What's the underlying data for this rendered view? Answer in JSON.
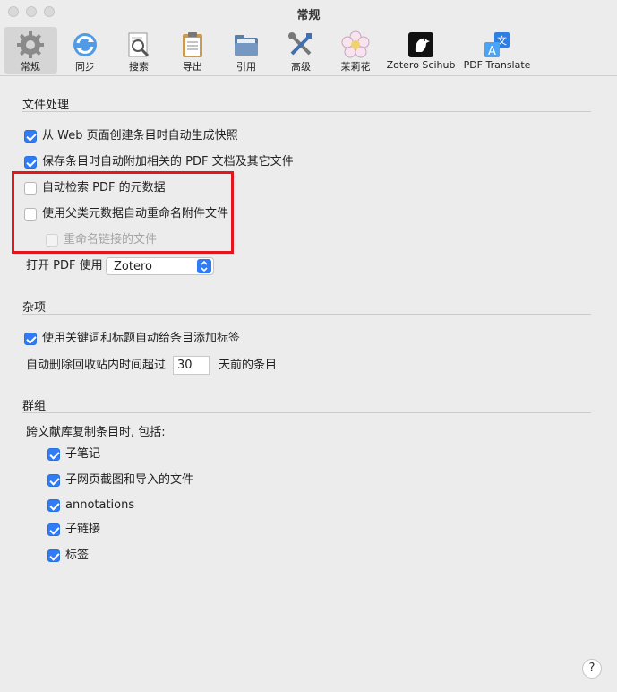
{
  "window": {
    "title": "常规"
  },
  "toolbar": {
    "items": [
      {
        "label": "常规"
      },
      {
        "label": "同步"
      },
      {
        "label": "搜索"
      },
      {
        "label": "导出"
      },
      {
        "label": "引用"
      },
      {
        "label": "高级"
      },
      {
        "label": "茉莉花"
      },
      {
        "label": "Zotero Scihub"
      },
      {
        "label": "PDF Translate"
      }
    ]
  },
  "file_handling": {
    "title": "文件处理",
    "snapshot": "从 Web 页面创建条目时自动生成快照",
    "attach_pdf": "保存条目时自动附加相关的 PDF 文档及其它文件",
    "retrieve_metadata": "自动检索 PDF 的元数据",
    "rename_attachments": "使用父类元数据自动重命名附件文件",
    "rename_linked": "重命名链接的文件",
    "open_pdf_label": "打开 PDF 使用",
    "open_pdf_value": "Zotero"
  },
  "misc": {
    "title": "杂项",
    "auto_tags": "使用关键词和标题自动给条目添加标签",
    "trash_prefix": "自动删除回收站内时间超过",
    "trash_days": "30",
    "trash_suffix": "天前的条目"
  },
  "groups": {
    "title": "群组",
    "copy_label": "跨文献库复制条目时, 包括:",
    "child_notes": "子笔记",
    "child_snapshots": "子网页截图和导入的文件",
    "annotations": "annotations",
    "child_links": "子链接",
    "tags": "标签"
  },
  "help": {
    "label": "?"
  },
  "colors": {
    "accent": "#2f7cf6",
    "highlight": "#e3161e"
  }
}
